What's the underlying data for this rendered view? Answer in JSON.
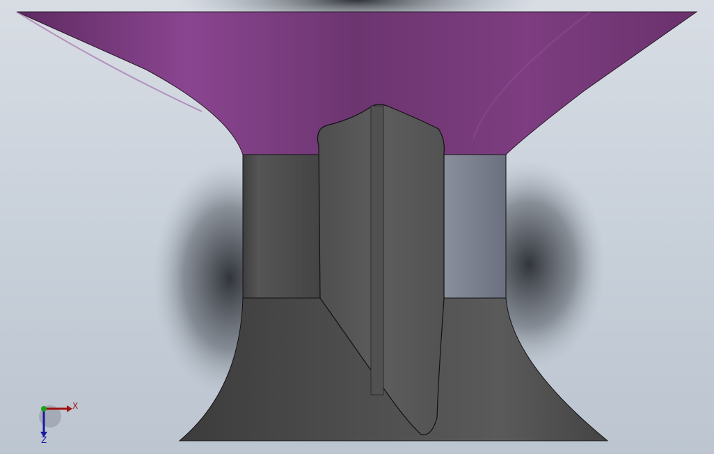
{
  "viewport": {
    "background_top": "#d8dde4",
    "background_bottom": "#bcc5d0"
  },
  "model": {
    "funnel_color": "#7a3a7d",
    "body_color": "#4d4d4d",
    "blade_color": "#595959",
    "right_panel_color": "#7a7f8f"
  },
  "triad": {
    "x_label": "X",
    "z_label": "Z",
    "x_color": "#a01212",
    "y_color": "#1aa31a",
    "z_color": "#1a1aa0"
  }
}
